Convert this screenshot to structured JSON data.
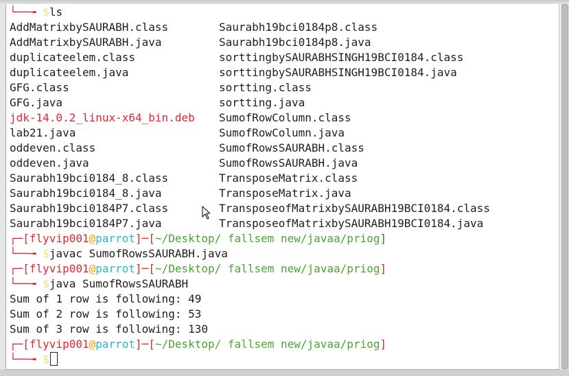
{
  "terminal": {
    "first_prompt": {
      "frame": "└──╼ ",
      "dollar": "$",
      "command": "ls"
    },
    "ls_output": [
      [
        "AddMatrixbySAURABH.class",
        "Saurabh19bci0184p8.class"
      ],
      [
        "AddMatrixbySAURABH.java",
        "Saurabh19bci0184p8.java"
      ],
      [
        "duplicateelem.class",
        "sorttingbySAURABHSINGH19BCI0184.class"
      ],
      [
        "duplicateelem.java",
        "sorttingbySAURABHSINGH19BCI0184.java"
      ],
      [
        "GFG.class",
        "sortting.class"
      ],
      [
        "GFG.java",
        "sortting.java"
      ],
      [
        "jdk-14.0.2_linux-x64_bin.deb",
        "SumofRowColumn.class"
      ],
      [
        "lab21.java",
        "SumofRowColumn.java"
      ],
      [
        "oddeven.class",
        "SumofRowsSAURABH.class"
      ],
      [
        "oddeven.java",
        "SumofRowsSAURABH.java"
      ],
      [
        "Saurabh19bci0184_8.class",
        "TransposeMatrix.class"
      ],
      [
        "Saurabh19bci0184_8.java",
        "TransposeMatrix.java"
      ],
      [
        "Saurabh19bci0184P7.class",
        "TransposeofMatrixbySAURABH19BCI0184.class"
      ],
      [
        "Saurabh19bci0184P7.java",
        "TransposeofMatrixbySAURABH19BCI0184.java"
      ]
    ],
    "prompt": {
      "open": "┌─[",
      "user": "flyvip001",
      "at": "@",
      "host": "parrot",
      "mid": "]─[",
      "path": "~/Desktop/ fallsem new/javaa/priog",
      "close": "]",
      "frame_bottom": "└──╼ ",
      "dollar": "$"
    },
    "cmd_compile": "javac SumofRowsSAURABH.java",
    "cmd_run": "java SumofRowsSAURABH",
    "program_output": [
      "Sum of 1 row is following: 49",
      "Sum of 2 row is following: 53",
      "Sum of 3 row is following: 130"
    ]
  },
  "colors": {
    "background": "#ffffff",
    "text": "#1e1e1e",
    "prompt_frame": "#e0262c",
    "prompt_host": "#27b5c9",
    "prompt_path": "#49a531",
    "dollar": "#e9e27e",
    "deb_file": "#e0262c"
  }
}
